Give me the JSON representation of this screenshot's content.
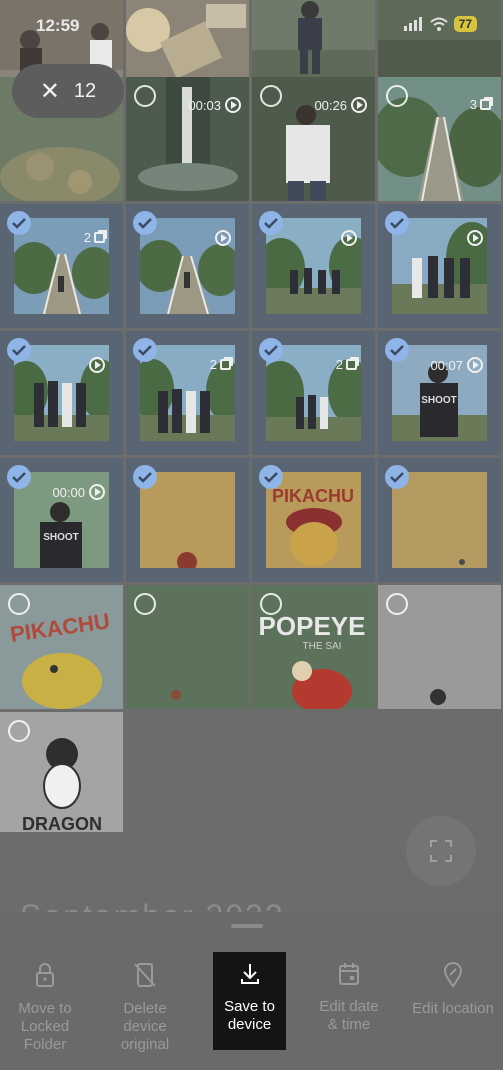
{
  "status": {
    "time": "12:59",
    "battery": "77"
  },
  "selection": {
    "count": "12",
    "close_icon": "close-icon"
  },
  "grid": [
    {
      "id": "r0c0",
      "selected": false,
      "video": null,
      "count": null
    },
    {
      "id": "r0c1",
      "selected": false,
      "video": null,
      "count": null
    },
    {
      "id": "r0c2",
      "selected": false,
      "video": null,
      "count": null
    },
    {
      "id": "r0c3",
      "selected": false,
      "video": null,
      "count": null
    },
    {
      "id": "r1c0",
      "selected": false,
      "video": null,
      "count": null
    },
    {
      "id": "r1c1",
      "selected": false,
      "video": "00:03",
      "count": null
    },
    {
      "id": "r1c2",
      "selected": false,
      "video": "00:26",
      "count": null
    },
    {
      "id": "r1c3",
      "selected": false,
      "video": null,
      "count": "3"
    },
    {
      "id": "r2c0",
      "selected": true,
      "video": null,
      "count": "2"
    },
    {
      "id": "r2c1",
      "selected": true,
      "video": "",
      "count": null
    },
    {
      "id": "r2c2",
      "selected": true,
      "video": "",
      "count": null
    },
    {
      "id": "r2c3",
      "selected": true,
      "video": "",
      "count": null
    },
    {
      "id": "r3c0",
      "selected": true,
      "video": "",
      "count": null
    },
    {
      "id": "r3c1",
      "selected": true,
      "video": null,
      "count": "2"
    },
    {
      "id": "r3c2",
      "selected": true,
      "video": null,
      "count": "2"
    },
    {
      "id": "r3c3",
      "selected": true,
      "video": "00:07",
      "count": null
    },
    {
      "id": "r4c0",
      "selected": true,
      "video": "00:00",
      "count": null
    },
    {
      "id": "r4c1",
      "selected": true,
      "video": null,
      "count": null
    },
    {
      "id": "r4c2",
      "selected": true,
      "video": null,
      "count": null
    },
    {
      "id": "r4c3",
      "selected": true,
      "video": null,
      "count": null
    },
    {
      "id": "r5c0",
      "selected": false,
      "video": null,
      "count": null
    },
    {
      "id": "r5c1",
      "selected": false,
      "video": null,
      "count": null
    },
    {
      "id": "r5c2",
      "selected": false,
      "video": null,
      "count": null
    },
    {
      "id": "r5c3",
      "selected": false,
      "video": null,
      "count": null
    },
    {
      "id": "r6c0",
      "selected": false,
      "video": null,
      "count": null
    }
  ],
  "image_text": {
    "pikachu": "PIKACHU",
    "popeye": "POPEYE",
    "popeye_sub": "THE SAI",
    "dragon": "DRAGON"
  },
  "month_peek": "September 2023",
  "actions": [
    {
      "label": "Move to\nLocked\nFolder",
      "icon": "lock-icon",
      "highlighted": false
    },
    {
      "label": "Delete\ndevice\noriginal",
      "icon": "delete-phone-icon",
      "highlighted": false
    },
    {
      "label": "Save to\ndevice",
      "icon": "download-icon",
      "highlighted": true
    },
    {
      "label": "Edit date\n& time",
      "icon": "calendar-icon",
      "highlighted": false
    },
    {
      "label": "Edit location",
      "icon": "location-icon",
      "highlighted": false
    }
  ]
}
